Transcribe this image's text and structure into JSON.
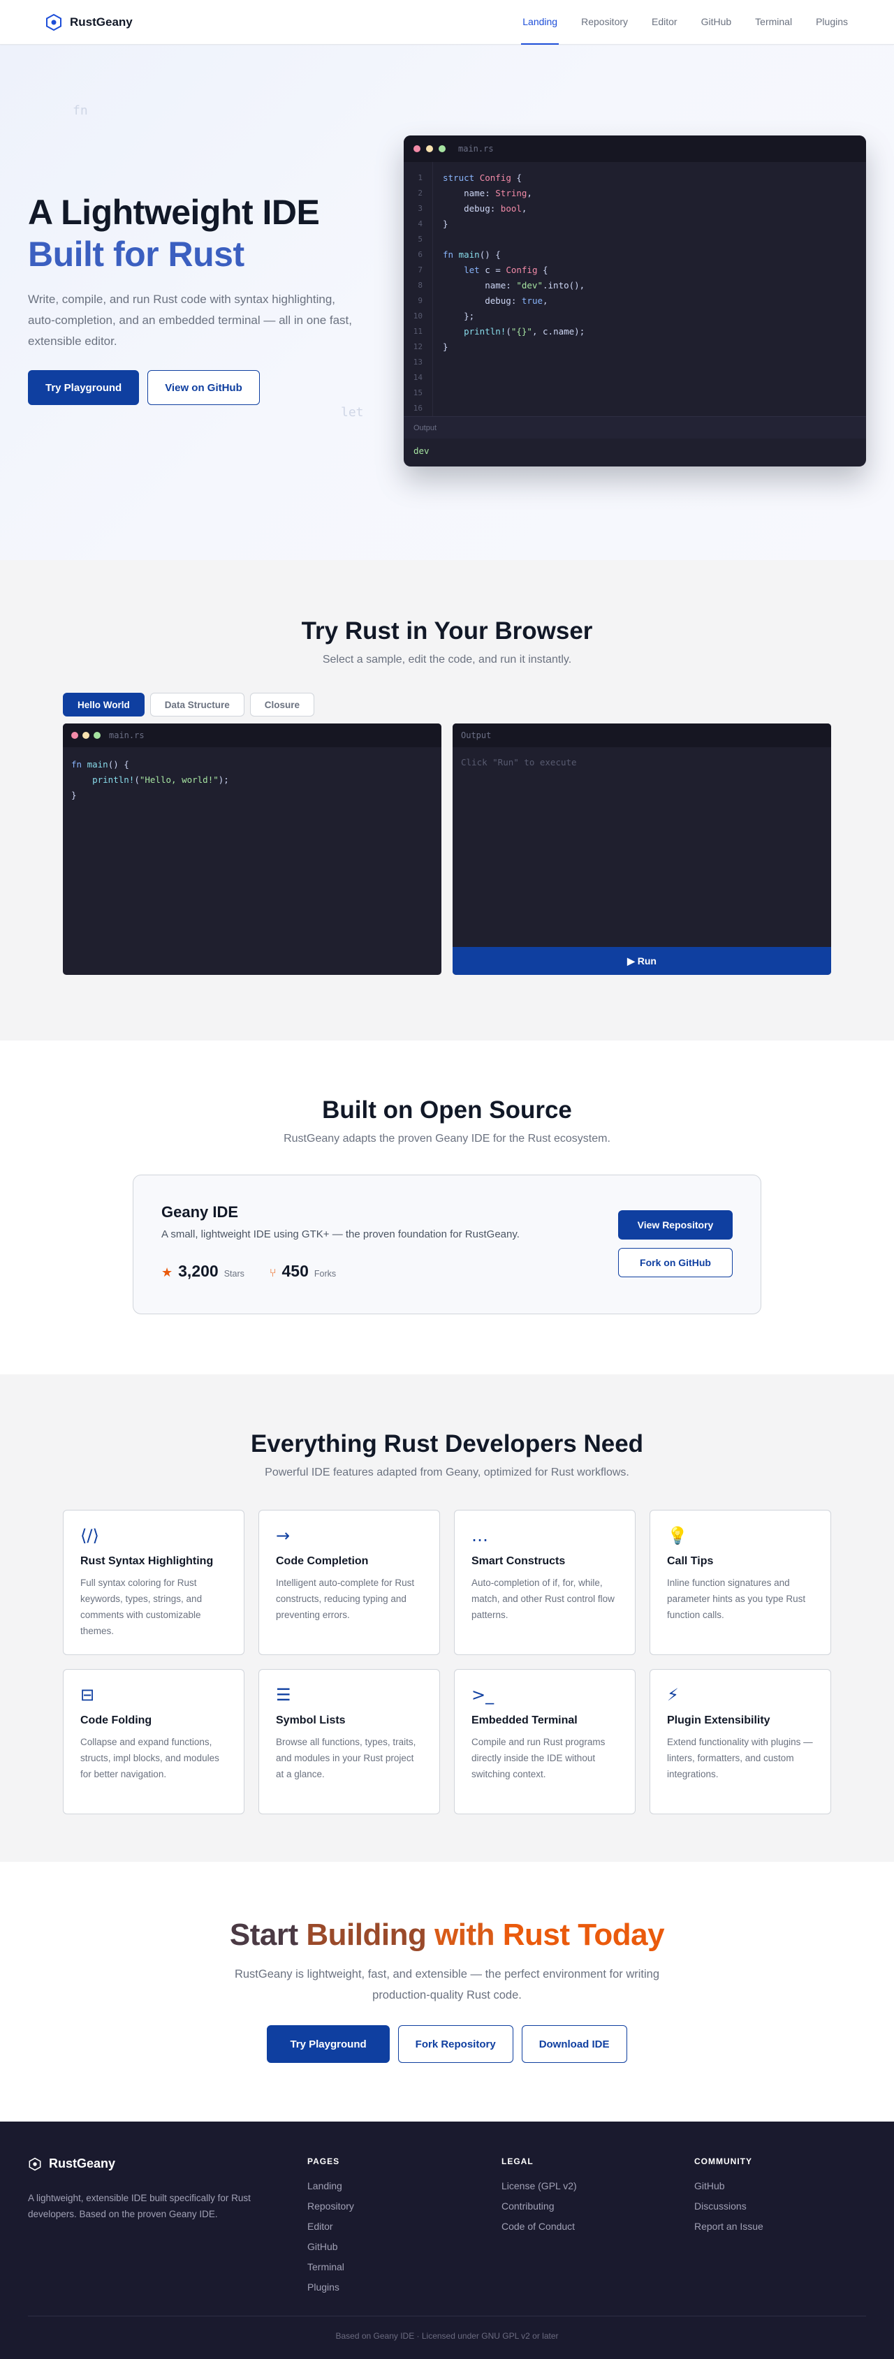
{
  "nav": {
    "brand": "RustGeany",
    "links": [
      "Landing",
      "Repository",
      "Editor",
      "GitHub",
      "Terminal",
      "Plugins"
    ],
    "active": "Landing"
  },
  "hero": {
    "title_line1": "A Lightweight IDE",
    "title_line2": "Built for Rust",
    "subtitle": "Write, compile, and run Rust code with syntax highlighting, auto-completion, and an embedded terminal — all in one fast, extensible editor.",
    "primary_button": "Try Playground",
    "secondary_button": "View on GitHub",
    "ghost_words": [
      "fn",
      "let"
    ],
    "editor": {
      "filename": "main.rs",
      "line_numbers": [
        "1",
        "2",
        "3",
        "4",
        "5",
        "6",
        "7",
        "8",
        "9",
        "10",
        "11",
        "12",
        "13",
        "14",
        "15",
        "16"
      ],
      "output_label": "Output",
      "output_text": "dev"
    }
  },
  "playground": {
    "title": "Try Rust in Your Browser",
    "subtitle": "Select a sample, edit the code, and run it instantly.",
    "tabs": [
      "Hello World",
      "Data Structure",
      "Closure"
    ],
    "active_tab": "Hello World",
    "filename": "main.rs",
    "output_label": "Output",
    "output_placeholder": "Click \"Run\" to execute",
    "run_button": "▶ Run"
  },
  "open_source": {
    "title": "Built on Open Source",
    "subtitle": "RustGeany adapts the proven Geany IDE for the Rust ecosystem.",
    "card_name": "Geany IDE",
    "card_desc": "A small, lightweight IDE using GTK+ — the proven foundation for RustGeany.",
    "stars_value": "3,200",
    "stars_label": "Stars",
    "forks_value": "450",
    "forks_label": "Forks",
    "view_button": "View Repository",
    "fork_button": "Fork on GitHub"
  },
  "features": {
    "title": "Everything Rust Developers Need",
    "subtitle": "Powerful IDE features adapted from Geany, optimized for Rust workflows.",
    "items": [
      {
        "icon": "⟨/⟩",
        "title": "Rust Syntax Highlighting",
        "desc": "Full syntax coloring for Rust keywords, types, strings, and comments with customizable themes."
      },
      {
        "icon": "→",
        "title": "Code Completion",
        "desc": "Intelligent auto-complete for Rust constructs, reducing typing and preventing errors."
      },
      {
        "icon": "…",
        "title": "Smart Constructs",
        "desc": "Auto-completion of if, for, while, match, and other Rust control flow patterns."
      },
      {
        "icon": "💡",
        "title": "Call Tips",
        "desc": "Inline function signatures and parameter hints as you type Rust function calls."
      },
      {
        "icon": "⊟",
        "title": "Code Folding",
        "desc": "Collapse and expand functions, structs, impl blocks, and modules for better navigation."
      },
      {
        "icon": "☰",
        "title": "Symbol Lists",
        "desc": "Browse all functions, types, traits, and modules in your Rust project at a glance."
      },
      {
        "icon": ">_",
        "title": "Embedded Terminal",
        "desc": "Compile and run Rust programs directly inside the IDE without switching context."
      },
      {
        "icon": "⚡",
        "title": "Plugin Extensibility",
        "desc": "Extend functionality with plugins — linters, formatters, and custom integrations."
      }
    ]
  },
  "cta": {
    "title_part1": "Start ",
    "title_part2": "Building ",
    "title_part3": "with ",
    "title_part4": "Rust Today",
    "subtitle": "RustGeany is lightweight, fast, and extensible — the perfect environment for writing production-quality Rust code.",
    "buttons": [
      "Try Playground",
      "Fork Repository",
      "Download IDE"
    ]
  },
  "footer": {
    "brand": "RustGeany",
    "desc": "A lightweight, extensible IDE built specifically for Rust developers. Based on the proven Geany IDE.",
    "pages_heading": "PAGES",
    "pages": [
      "Landing",
      "Repository",
      "Editor",
      "GitHub",
      "Terminal",
      "Plugins"
    ],
    "legal_heading": "LEGAL",
    "legal": [
      "License (GPL v2)",
      "Contributing",
      "Code of Conduct"
    ],
    "community_heading": "COMMUNITY",
    "community": [
      "GitHub",
      "Discussions",
      "Report an Issue"
    ],
    "copyright": "Based on Geany IDE · Licensed under GNU GPL v2 or later"
  },
  "colors": {
    "primary": "#0f3fa0",
    "accent_blue": "#3b5fc0",
    "accent_orange": "#ea5a0c",
    "editor_bg": "#1f1f2e",
    "footer_bg": "#1a1a2e"
  }
}
